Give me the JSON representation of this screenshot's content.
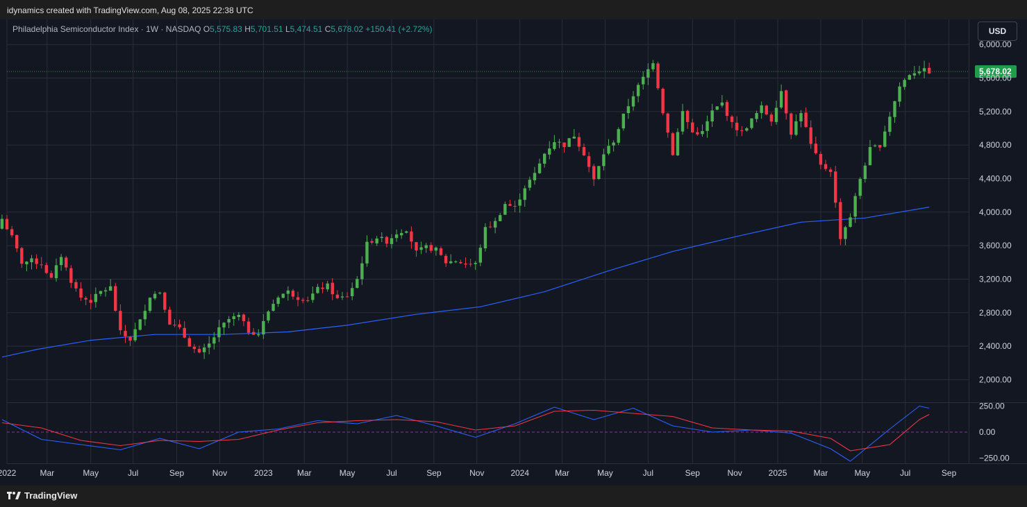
{
  "header": {
    "caption": "idynamics created with TradingView.com, Aug 08, 2025 22:38 UTC"
  },
  "footer": {
    "brand": "TradingView"
  },
  "legend": {
    "symbol": "Philadelphia Semiconductor Index · 1W · NASDAQ",
    "o_label": "O",
    "o_value": "5,575.83",
    "h_label": "H",
    "h_value": "5,701.51",
    "l_label": "L",
    "l_value": "5,474.51",
    "c_label": "C",
    "c_value": "5,678.02",
    "change": "+150.41 (+2.72%)"
  },
  "currency_button": "USD",
  "colors": {
    "up": "#4caf50",
    "down": "#f23645",
    "ma": "#2962ff",
    "osc_fast": "#2962ff",
    "osc_slow": "#f23645",
    "price_tag": "#1e9d4a",
    "background": "#131722"
  },
  "chart_data": [
    {
      "type": "candlestick",
      "price_axis": {
        "ticks": [
          2000,
          2400,
          2800,
          3200,
          3600,
          4000,
          4400,
          4800,
          5200,
          5600,
          6000
        ],
        "tick_labels": [
          "2,000.00",
          "2,400.00",
          "2,800.00",
          "3,200.00",
          "3,600.00",
          "4,000.00",
          "4,400.00",
          "4,800.00",
          "5,200.00",
          "5,600.00",
          "6,000.00"
        ],
        "range": [
          1730,
          6300
        ]
      },
      "last_price": 5678.02,
      "last_price_label": "5,678.02",
      "time_axis": {
        "start": "2022-01-03",
        "end": "2025-09-29",
        "ticks": [
          {
            "date": "2022-01-03",
            "label": "2022"
          },
          {
            "date": "2022-03-01",
            "label": "Mar"
          },
          {
            "date": "2022-05-02",
            "label": "May"
          },
          {
            "date": "2022-07-01",
            "label": "Jul"
          },
          {
            "date": "2022-09-01",
            "label": "Sep"
          },
          {
            "date": "2022-11-01",
            "label": "Nov"
          },
          {
            "date": "2023-01-02",
            "label": "2023"
          },
          {
            "date": "2023-03-01",
            "label": "Mar"
          },
          {
            "date": "2023-05-01",
            "label": "May"
          },
          {
            "date": "2023-07-03",
            "label": "Jul"
          },
          {
            "date": "2023-09-01",
            "label": "Sep"
          },
          {
            "date": "2023-11-01",
            "label": "Nov"
          },
          {
            "date": "2024-01-01",
            "label": "2024"
          },
          {
            "date": "2024-03-01",
            "label": "Mar"
          },
          {
            "date": "2024-05-01",
            "label": "May"
          },
          {
            "date": "2024-07-01",
            "label": "Jul"
          },
          {
            "date": "2024-09-02",
            "label": "Sep"
          },
          {
            "date": "2024-11-01",
            "label": "Nov"
          },
          {
            "date": "2025-01-01",
            "label": "2025"
          },
          {
            "date": "2025-03-03",
            "label": "Mar"
          },
          {
            "date": "2025-05-01",
            "label": "May"
          },
          {
            "date": "2025-07-01",
            "label": "Jul"
          },
          {
            "date": "2025-09-01",
            "label": "Sep"
          }
        ]
      },
      "weekly_close": [
        {
          "date": "2021-12-27",
          "close": 3920
        },
        {
          "date": "2022-01-10",
          "close": 3700
        },
        {
          "date": "2022-01-24",
          "close": 3400
        },
        {
          "date": "2022-02-07",
          "close": 3420
        },
        {
          "date": "2022-02-21",
          "close": 3380
        },
        {
          "date": "2022-03-07",
          "close": 3200
        },
        {
          "date": "2022-03-21",
          "close": 3480
        },
        {
          "date": "2022-04-04",
          "close": 3180
        },
        {
          "date": "2022-04-18",
          "close": 2980
        },
        {
          "date": "2022-05-02",
          "close": 2940
        },
        {
          "date": "2022-05-16",
          "close": 3050
        },
        {
          "date": "2022-05-30",
          "close": 3100
        },
        {
          "date": "2022-06-13",
          "close": 2560
        },
        {
          "date": "2022-06-27",
          "close": 2480
        },
        {
          "date": "2022-07-11",
          "close": 2700
        },
        {
          "date": "2022-07-25",
          "close": 3000
        },
        {
          "date": "2022-08-08",
          "close": 3050
        },
        {
          "date": "2022-08-22",
          "close": 2680
        },
        {
          "date": "2022-09-05",
          "close": 2600
        },
        {
          "date": "2022-09-19",
          "close": 2420
        },
        {
          "date": "2022-10-03",
          "close": 2300
        },
        {
          "date": "2022-10-17",
          "close": 2420
        },
        {
          "date": "2022-10-31",
          "close": 2600
        },
        {
          "date": "2022-11-14",
          "close": 2720
        },
        {
          "date": "2022-11-28",
          "close": 2760
        },
        {
          "date": "2022-12-12",
          "close": 2580
        },
        {
          "date": "2022-12-26",
          "close": 2550
        },
        {
          "date": "2023-01-09",
          "close": 2820
        },
        {
          "date": "2023-01-23",
          "close": 3000
        },
        {
          "date": "2023-02-06",
          "close": 3050
        },
        {
          "date": "2023-02-20",
          "close": 2980
        },
        {
          "date": "2023-03-06",
          "close": 2960
        },
        {
          "date": "2023-03-20",
          "close": 3080
        },
        {
          "date": "2023-04-03",
          "close": 3120
        },
        {
          "date": "2023-04-17",
          "close": 2960
        },
        {
          "date": "2023-05-01",
          "close": 3000
        },
        {
          "date": "2023-05-15",
          "close": 3200
        },
        {
          "date": "2023-05-29",
          "close": 3620
        },
        {
          "date": "2023-06-12",
          "close": 3700
        },
        {
          "date": "2023-06-26",
          "close": 3650
        },
        {
          "date": "2023-07-10",
          "close": 3750
        },
        {
          "date": "2023-07-24",
          "close": 3800
        },
        {
          "date": "2023-08-07",
          "close": 3520
        },
        {
          "date": "2023-08-21",
          "close": 3580
        },
        {
          "date": "2023-09-04",
          "close": 3550
        },
        {
          "date": "2023-09-18",
          "close": 3400
        },
        {
          "date": "2023-10-02",
          "close": 3420
        },
        {
          "date": "2023-10-16",
          "close": 3380
        },
        {
          "date": "2023-10-30",
          "close": 3380
        },
        {
          "date": "2023-11-13",
          "close": 3800
        },
        {
          "date": "2023-11-27",
          "close": 3880
        },
        {
          "date": "2023-12-11",
          "close": 4100
        },
        {
          "date": "2023-12-25",
          "close": 4050
        },
        {
          "date": "2024-01-08",
          "close": 4300
        },
        {
          "date": "2024-01-22",
          "close": 4450
        },
        {
          "date": "2024-02-05",
          "close": 4700
        },
        {
          "date": "2024-02-19",
          "close": 4850
        },
        {
          "date": "2024-03-04",
          "close": 4800
        },
        {
          "date": "2024-03-18",
          "close": 4920
        },
        {
          "date": "2024-04-01",
          "close": 4700
        },
        {
          "date": "2024-04-15",
          "close": 4380
        },
        {
          "date": "2024-04-29",
          "close": 4700
        },
        {
          "date": "2024-05-13",
          "close": 4850
        },
        {
          "date": "2024-05-27",
          "close": 5150
        },
        {
          "date": "2024-06-10",
          "close": 5400
        },
        {
          "date": "2024-06-24",
          "close": 5600
        },
        {
          "date": "2024-07-08",
          "close": 5800
        },
        {
          "date": "2024-07-22",
          "close": 5200
        },
        {
          "date": "2024-08-05",
          "close": 4700
        },
        {
          "date": "2024-08-19",
          "close": 5200
        },
        {
          "date": "2024-09-02",
          "close": 4950
        },
        {
          "date": "2024-09-16",
          "close": 4950
        },
        {
          "date": "2024-09-30",
          "close": 5200
        },
        {
          "date": "2024-10-14",
          "close": 5300
        },
        {
          "date": "2024-10-28",
          "close": 5050
        },
        {
          "date": "2024-11-11",
          "close": 4950
        },
        {
          "date": "2024-11-25",
          "close": 5100
        },
        {
          "date": "2024-12-09",
          "close": 5250
        },
        {
          "date": "2024-12-23",
          "close": 5100
        },
        {
          "date": "2025-01-06",
          "close": 5450
        },
        {
          "date": "2025-01-20",
          "close": 4950
        },
        {
          "date": "2025-02-03",
          "close": 5200
        },
        {
          "date": "2025-02-17",
          "close": 4800
        },
        {
          "date": "2025-03-03",
          "close": 4550
        },
        {
          "date": "2025-03-17",
          "close": 4500
        },
        {
          "date": "2025-03-31",
          "close": 3700
        },
        {
          "date": "2025-04-14",
          "close": 3950
        },
        {
          "date": "2025-04-28",
          "close": 4400
        },
        {
          "date": "2025-05-12",
          "close": 4750
        },
        {
          "date": "2025-05-26",
          "close": 4800
        },
        {
          "date": "2025-06-09",
          "close": 5150
        },
        {
          "date": "2025-06-23",
          "close": 5500
        },
        {
          "date": "2025-07-07",
          "close": 5650
        },
        {
          "date": "2025-07-21",
          "close": 5700
        },
        {
          "date": "2025-08-04",
          "close": 5678
        }
      ],
      "moving_average": [
        {
          "date": "2021-12-27",
          "value": 2270
        },
        {
          "date": "2022-02-14",
          "value": 2360
        },
        {
          "date": "2022-05-02",
          "value": 2470
        },
        {
          "date": "2022-08-01",
          "value": 2540
        },
        {
          "date": "2022-11-07",
          "value": 2540
        },
        {
          "date": "2023-02-06",
          "value": 2570
        },
        {
          "date": "2023-05-01",
          "value": 2650
        },
        {
          "date": "2023-08-07",
          "value": 2780
        },
        {
          "date": "2023-11-06",
          "value": 2870
        },
        {
          "date": "2024-02-05",
          "value": 3050
        },
        {
          "date": "2024-05-06",
          "value": 3300
        },
        {
          "date": "2024-08-05",
          "value": 3530
        },
        {
          "date": "2024-11-04",
          "value": 3710
        },
        {
          "date": "2025-02-03",
          "value": 3880
        },
        {
          "date": "2025-05-05",
          "value": 3930
        },
        {
          "date": "2025-08-04",
          "value": 4060
        }
      ]
    },
    {
      "type": "line",
      "axis": {
        "ticks": [
          250,
          0,
          -250
        ],
        "tick_labels": [
          "250.00",
          "0.00",
          "−250.00"
        ],
        "range": [
          -300,
          280
        ]
      },
      "series": [
        {
          "color": "#2962ff",
          "points": [
            {
              "date": "2021-12-27",
              "value": 120
            },
            {
              "date": "2022-02-21",
              "value": -70
            },
            {
              "date": "2022-04-18",
              "value": -120
            },
            {
              "date": "2022-06-13",
              "value": -170
            },
            {
              "date": "2022-08-08",
              "value": -60
            },
            {
              "date": "2022-10-03",
              "value": -160
            },
            {
              "date": "2022-11-28",
              "value": 0
            },
            {
              "date": "2023-01-23",
              "value": 30
            },
            {
              "date": "2023-03-20",
              "value": 110
            },
            {
              "date": "2023-05-15",
              "value": 80
            },
            {
              "date": "2023-07-10",
              "value": 160
            },
            {
              "date": "2023-09-04",
              "value": 60
            },
            {
              "date": "2023-10-30",
              "value": -50
            },
            {
              "date": "2023-12-25",
              "value": 80
            },
            {
              "date": "2024-02-19",
              "value": 240
            },
            {
              "date": "2024-04-15",
              "value": 120
            },
            {
              "date": "2024-06-10",
              "value": 230
            },
            {
              "date": "2024-08-05",
              "value": 60
            },
            {
              "date": "2024-09-30",
              "value": 0
            },
            {
              "date": "2024-11-25",
              "value": 20
            },
            {
              "date": "2025-01-20",
              "value": -10
            },
            {
              "date": "2025-03-17",
              "value": -160
            },
            {
              "date": "2025-04-14",
              "value": -280
            },
            {
              "date": "2025-06-09",
              "value": 30
            },
            {
              "date": "2025-07-21",
              "value": 250
            },
            {
              "date": "2025-08-04",
              "value": 230
            }
          ]
        },
        {
          "color": "#f23645",
          "points": [
            {
              "date": "2021-12-27",
              "value": 90
            },
            {
              "date": "2022-02-21",
              "value": 40
            },
            {
              "date": "2022-04-18",
              "value": -80
            },
            {
              "date": "2022-06-13",
              "value": -130
            },
            {
              "date": "2022-08-08",
              "value": -80
            },
            {
              "date": "2022-10-03",
              "value": -90
            },
            {
              "date": "2022-11-28",
              "value": -70
            },
            {
              "date": "2023-01-23",
              "value": 20
            },
            {
              "date": "2023-03-20",
              "value": 90
            },
            {
              "date": "2023-05-15",
              "value": 110
            },
            {
              "date": "2023-07-10",
              "value": 120
            },
            {
              "date": "2023-09-04",
              "value": 100
            },
            {
              "date": "2023-10-30",
              "value": 20
            },
            {
              "date": "2023-12-25",
              "value": 60
            },
            {
              "date": "2024-02-19",
              "value": 200
            },
            {
              "date": "2024-04-15",
              "value": 210
            },
            {
              "date": "2024-06-10",
              "value": 180
            },
            {
              "date": "2024-08-05",
              "value": 150
            },
            {
              "date": "2024-09-30",
              "value": 40
            },
            {
              "date": "2024-11-25",
              "value": 20
            },
            {
              "date": "2025-01-20",
              "value": 10
            },
            {
              "date": "2025-03-17",
              "value": -60
            },
            {
              "date": "2025-04-14",
              "value": -180
            },
            {
              "date": "2025-06-09",
              "value": -120
            },
            {
              "date": "2025-07-21",
              "value": 120
            },
            {
              "date": "2025-08-04",
              "value": 170
            }
          ]
        }
      ]
    }
  ]
}
